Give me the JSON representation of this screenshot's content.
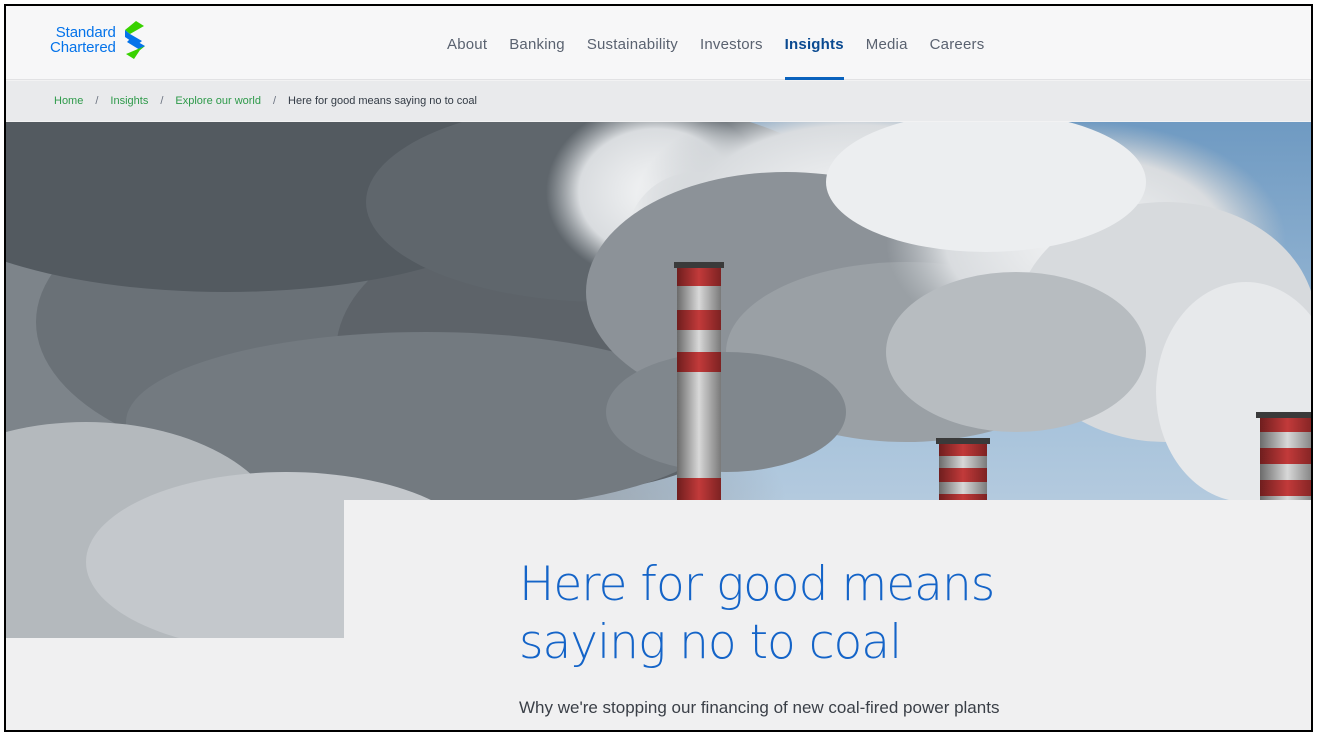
{
  "brand": {
    "name_line1": "Standard",
    "name_line2": "Chartered",
    "colors": {
      "blue": "#0473ea",
      "green": "#38d200",
      "dark_blue": "#0a4a91"
    }
  },
  "nav": {
    "items": [
      {
        "label": "About",
        "active": false
      },
      {
        "label": "Banking",
        "active": false
      },
      {
        "label": "Sustainability",
        "active": false
      },
      {
        "label": "Investors",
        "active": false
      },
      {
        "label": "Insights",
        "active": true
      },
      {
        "label": "Media",
        "active": false
      },
      {
        "label": "Careers",
        "active": false
      }
    ]
  },
  "breadcrumb": {
    "items": [
      "Home",
      "Insights",
      "Explore our world"
    ],
    "separator": "/",
    "current": "Here for good means saying no to coal"
  },
  "hero": {
    "image": "smokestacks-emitting-smoke"
  },
  "article": {
    "title_line1": "Here for good means",
    "title_line2": "saying no to coal",
    "subtitle": "Why we're stopping our financing of new coal-fired power plants"
  }
}
